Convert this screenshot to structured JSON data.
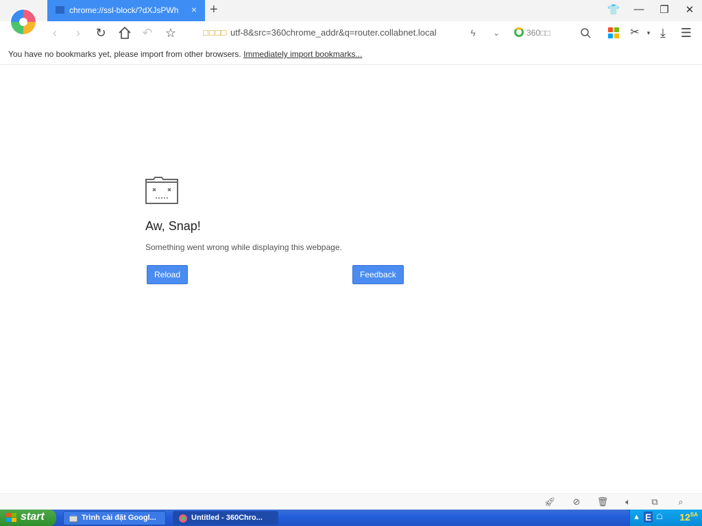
{
  "tab": {
    "title": "chrome://ssl-block/?dXJsPWh",
    "close": "×",
    "new_tab": "+"
  },
  "window": {
    "skin": "👕",
    "minimize": "—",
    "restore": "❐",
    "close": "✕"
  },
  "toolbar": {
    "address_prefix": "□□□□",
    "url": "utf-8&src=360chrome_addr&q=router.collabnet.local",
    "search_engine": "360□□"
  },
  "bookmarks": {
    "message": "You have no bookmarks yet, please import from other browsers. ",
    "import_link": "Immediately import bookmarks..."
  },
  "error": {
    "heading": "Aw, Snap!",
    "description": "Something went wrong while displaying this webpage.",
    "reload_label": "Reload",
    "feedback_label": "Feedback"
  },
  "taskbar": {
    "start_label": "start",
    "tasks": [
      {
        "label": "Trình cài đặt Googl..."
      },
      {
        "label": "Untitled - 360Chro..."
      }
    ],
    "tray_lang": "E",
    "clock_time": "12",
    "clock_suffix": "SA"
  },
  "colors": {
    "tab_active": "#3d8df5",
    "button": "#4a8cf0",
    "taskbar": "#245edb",
    "start": "#3c9a38"
  }
}
